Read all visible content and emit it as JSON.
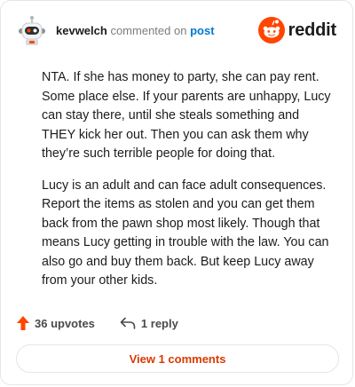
{
  "comment": {
    "username": "kevwelch",
    "action_text": "commented on",
    "target_link": "post",
    "paragraphs": [
      "NTA. If she has money to party, she can pay rent. Some place else. If your parents are unhappy, Lucy can stay there, until she steals something and THEY kick her out. Then you can ask them why they’re such terrible people for doing that.",
      "Lucy is an adult and can face adult consequences. Report the items as stolen and you can get them back from the pawn shop most likely. Though that means Lucy getting in trouble with the law. You can also go and buy them back. But keep Lucy away from your other kids."
    ]
  },
  "brand": {
    "name": "reddit",
    "icon": "reddit-logo-icon",
    "color": "#ff4500"
  },
  "actions": {
    "upvotes_label": "36 upvotes",
    "upvote_icon": "upvote-arrow-icon",
    "upvote_color": "#ff4500",
    "reply_label": "1 reply",
    "reply_icon": "reply-arrow-icon"
  },
  "view_comments_label": "View 1 comments",
  "colors": {
    "accent": "#d93a00",
    "link": "#0079d3"
  }
}
